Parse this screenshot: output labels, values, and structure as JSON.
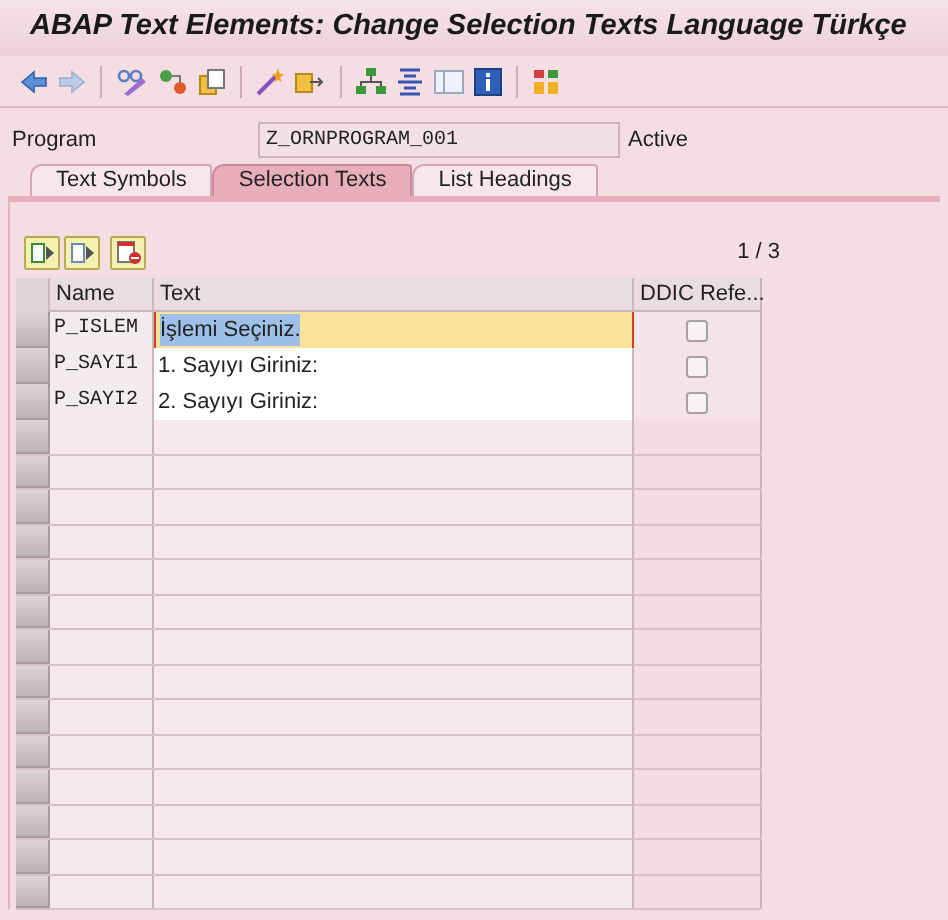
{
  "window": {
    "title": "ABAP Text Elements: Change Selection Texts Language Türkçe"
  },
  "program": {
    "label": "Program",
    "value": "Z_ORNPROGRAM_001",
    "status": "Active"
  },
  "tabs": [
    {
      "label": "Text Symbols",
      "selected": false
    },
    {
      "label": "Selection Texts",
      "selected": true
    },
    {
      "label": "List Headings",
      "selected": false
    }
  ],
  "page_indicator": "1 / 3",
  "table": {
    "columns": [
      "Name",
      "Text",
      "DDIC Refe..."
    ],
    "rows": [
      {
        "name": "P_ISLEM",
        "text": "İşlemi Seçiniz.",
        "ddic_reference": false,
        "selected": true
      },
      {
        "name": "P_SAYI1",
        "text": "1. Sayıyı Giriniz:",
        "ddic_reference": false,
        "selected": false
      },
      {
        "name": "P_SAYI2",
        "text": "2. Sayıyı Giriniz:",
        "ddic_reference": false,
        "selected": false
      }
    ]
  }
}
